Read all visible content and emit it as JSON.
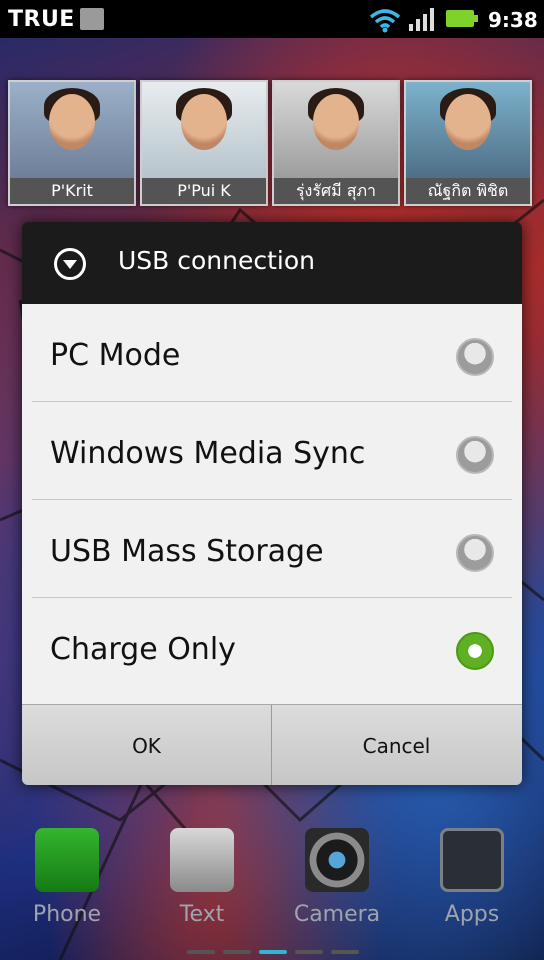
{
  "status_bar": {
    "carrier": "TRUE",
    "time": "9:38",
    "icons": [
      "usb-icon",
      "wifi-icon",
      "signal-icon",
      "battery-icon"
    ]
  },
  "contacts": [
    {
      "name": "P'Krit"
    },
    {
      "name": "P'Pui K"
    },
    {
      "name": "รุ่งรัศมี สุภา"
    },
    {
      "name": "ณัฐกิต พิชิต"
    }
  ],
  "dialog": {
    "title": "USB connection",
    "options": [
      {
        "label": "PC Mode",
        "selected": false
      },
      {
        "label": "Windows Media Sync",
        "selected": false
      },
      {
        "label": "USB Mass Storage",
        "selected": false
      },
      {
        "label": "Charge Only",
        "selected": true
      }
    ],
    "ok_label": "OK",
    "cancel_label": "Cancel"
  },
  "dock": {
    "items": [
      {
        "label": "Phone",
        "icon": "phone-icon"
      },
      {
        "label": "Text",
        "icon": "text-icon"
      },
      {
        "label": "Camera",
        "icon": "camera-icon"
      },
      {
        "label": "Apps",
        "icon": "apps-icon"
      }
    ]
  },
  "colors": {
    "accent_selected": "#5fb022",
    "header_bg": "#1b1b1b",
    "page_indicator_active": "#2fb5d6"
  }
}
